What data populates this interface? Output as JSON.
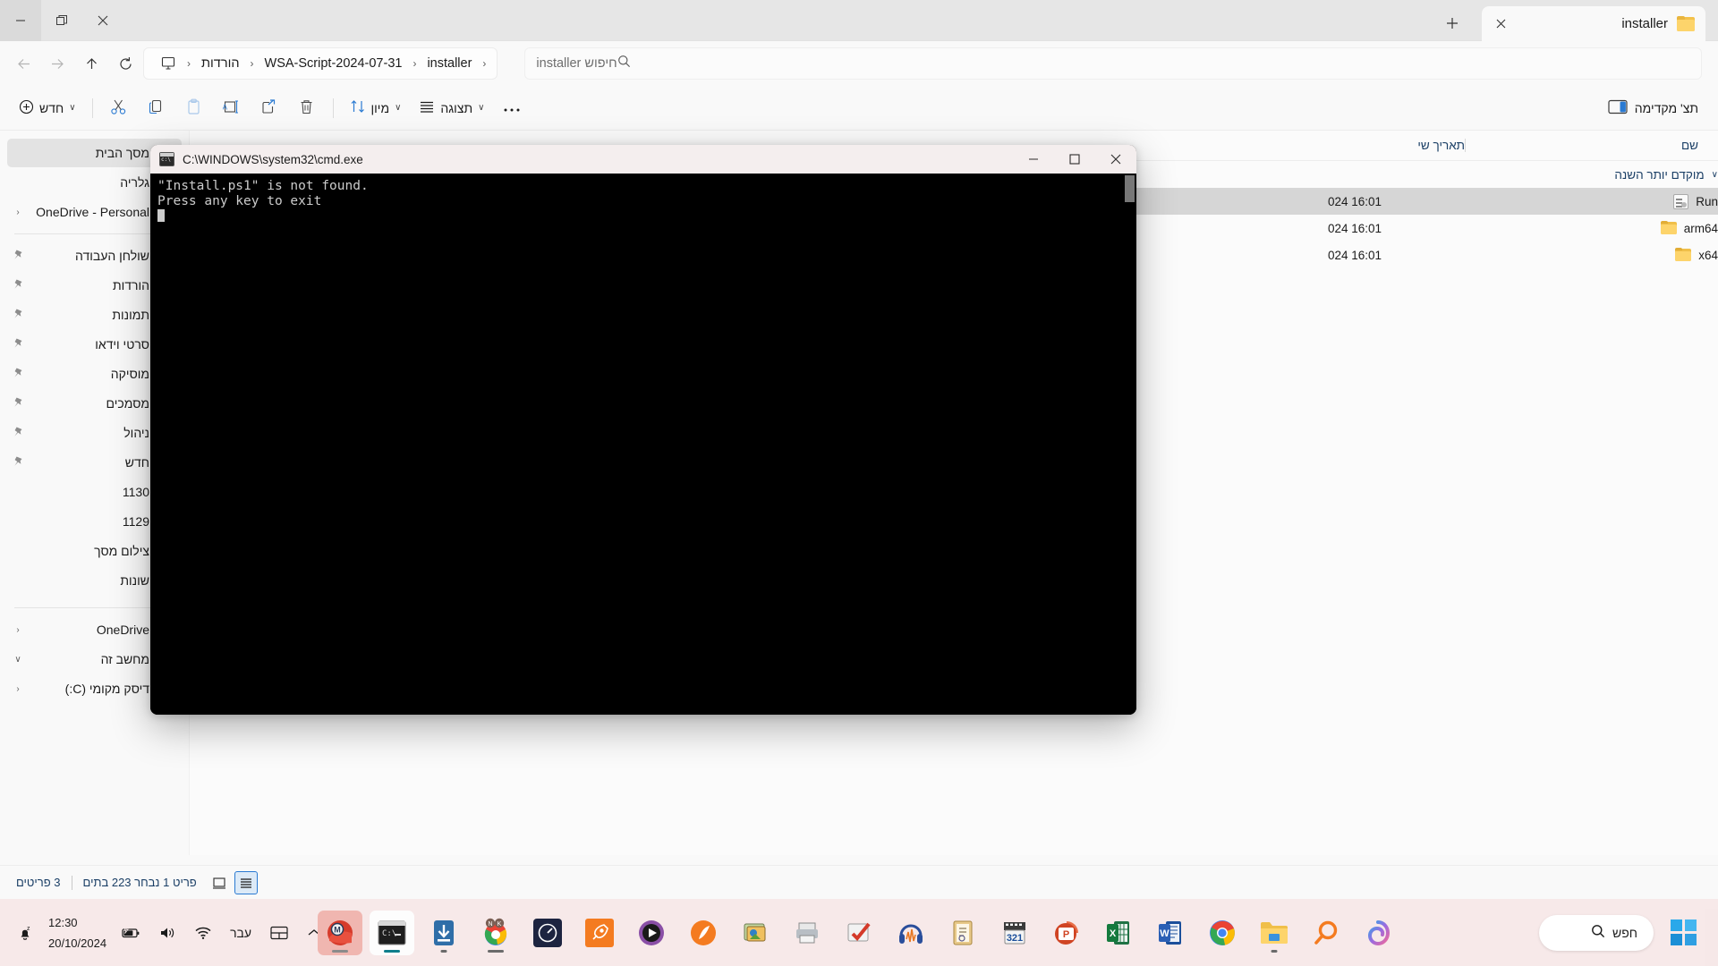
{
  "window": {
    "tab_title": "installer",
    "tab_close_icon": "close-icon",
    "newtab_icon": "plus-icon",
    "controls": {
      "minimize": "minimize-icon",
      "maximize": "restore-icon",
      "close": "close-icon"
    }
  },
  "nav": {
    "back_icon": "arrow-back-icon",
    "forward_icon": "arrow-forward-icon",
    "up_icon": "arrow-up-icon",
    "refresh_icon": "refresh-icon",
    "breadcrumbs": [
      {
        "label": "installer",
        "icon": ""
      },
      {
        "label": "WSA-Script-2024-07-31",
        "icon": ""
      },
      {
        "label": "הורדות",
        "icon": ""
      },
      {
        "label": "",
        "icon": "this-pc-icon"
      }
    ],
    "separator": "‹"
  },
  "search": {
    "placeholder": "חיפוש installer",
    "icon": "search-icon"
  },
  "toolbar": {
    "new_label": "חדש",
    "new_icon": "plus-circle-icon",
    "cut_icon": "scissors-icon",
    "copy_icon": "copy-icon",
    "paste_icon": "paste-icon",
    "rename_icon": "rename-icon",
    "share_icon": "share-icon",
    "delete_icon": "trash-icon",
    "sort_label": "מיון",
    "sort_icon": "sort-icon",
    "view_label": "תצוגה",
    "view_icon": "list-icon",
    "more_icon": "ellipsis-icon",
    "preview_label": "תצ' מקדימה",
    "preview_icon": "preview-pane-icon",
    "chevron": "∨"
  },
  "columns": {
    "name": "שם",
    "date": "תאריך שי"
  },
  "group": {
    "label": "מוקדם יותר השנה",
    "chevron": "∨"
  },
  "files": [
    {
      "name": "Run",
      "date": "024 16:01",
      "icon": "script-file-icon",
      "selected": true
    },
    {
      "name": "arm64",
      "date": "024 16:01",
      "icon": "folder-icon",
      "selected": false
    },
    {
      "name": "x64",
      "date": "024 16:01",
      "icon": "folder-icon",
      "selected": false
    }
  ],
  "sidebar": [
    {
      "label": "מסך הבית",
      "icon": "home-icon",
      "active": true,
      "pin": false,
      "expander": ""
    },
    {
      "label": "גלריה",
      "icon": "gallery-icon",
      "active": false,
      "pin": false,
      "expander": ""
    },
    {
      "label": "OneDrive - Personal",
      "icon": "onedrive-icon",
      "active": false,
      "pin": false,
      "expander": "‹"
    },
    {
      "sep": true
    },
    {
      "label": "שולחן העבודה",
      "icon": "desktop-icon",
      "active": false,
      "pin": true,
      "expander": ""
    },
    {
      "label": "הורדות",
      "icon": "downloads-icon",
      "active": false,
      "pin": true,
      "expander": ""
    },
    {
      "label": "תמונות",
      "icon": "pictures-icon",
      "active": false,
      "pin": true,
      "expander": ""
    },
    {
      "label": "סרטי וידאו",
      "icon": "videos-icon",
      "active": false,
      "pin": true,
      "expander": ""
    },
    {
      "label": "מוסיקה",
      "icon": "music-icon",
      "active": false,
      "pin": true,
      "expander": ""
    },
    {
      "label": "מסמכים",
      "icon": "documents-icon",
      "active": false,
      "pin": true,
      "expander": ""
    },
    {
      "label": "ניהול",
      "icon": "folder-icon",
      "active": false,
      "pin": true,
      "expander": ""
    },
    {
      "label": "חדש",
      "icon": "folder-icon",
      "active": false,
      "pin": true,
      "expander": ""
    },
    {
      "label": "1130",
      "icon": "folder-icon",
      "active": false,
      "pin": false,
      "expander": ""
    },
    {
      "label": "1129",
      "icon": "folder-icon",
      "active": false,
      "pin": false,
      "expander": ""
    },
    {
      "label": "צילום מסך",
      "icon": "folder-icon",
      "active": false,
      "pin": false,
      "expander": ""
    },
    {
      "label": "שונות",
      "icon": "folder-icon",
      "active": false,
      "pin": false,
      "expander": ""
    },
    {
      "sep": true
    },
    {
      "label": "OneDrive",
      "icon": "onedrive-icon",
      "active": false,
      "pin": false,
      "expander": "‹"
    },
    {
      "label": "מחשב זה",
      "icon": "this-pc-icon",
      "active": false,
      "pin": false,
      "expander": "∨"
    },
    {
      "label": "דיסק מקומי (C:)",
      "icon": "drive-icon",
      "active": false,
      "pin": false,
      "expander": "‹"
    }
  ],
  "status": {
    "items_count": "3 פריטים",
    "selection": "פריט 1 נבחר  223 בתים",
    "view_grid_icon": "grid-view-icon",
    "view_details_icon": "details-view-icon"
  },
  "cmd": {
    "title": "C:\\WINDOWS\\system32\\cmd.exe",
    "icon": "cmd-icon",
    "minimize": "–",
    "maximize": "☐",
    "close": "✕",
    "lines": [
      "\"Install.ps1\" is not found.",
      "Press any key to exit"
    ]
  },
  "taskbar": {
    "notification_icon": "notification-bell-icon",
    "time": "12:30",
    "date": "20/10/2024",
    "battery_icon": "battery-charging-icon",
    "volume_icon": "volume-icon",
    "wifi_icon": "wifi-icon",
    "keyboard_layout": "עבר",
    "widgets_icon": "widgets-icon",
    "overflow_icon": "show-hidden-icons-chevron",
    "search_pill": {
      "label": "חפש",
      "icon": "search-icon"
    },
    "start_icon": "windows-start-icon",
    "apps": [
      {
        "name": "mega-sync-app",
        "state": "active-red",
        "indicator": "grey-bar"
      },
      {
        "name": "command-prompt-app",
        "state": "active-white",
        "indicator": "teal"
      },
      {
        "name": "downloader-app",
        "state": "",
        "indicator": "dot"
      },
      {
        "name": "chrome-canary-app",
        "state": "",
        "indicator": "bar"
      },
      {
        "name": "speedtest-app",
        "state": "",
        "indicator": ""
      },
      {
        "name": "rocket-launcher-app",
        "state": "",
        "indicator": ""
      },
      {
        "name": "media-player-app",
        "state": "",
        "indicator": ""
      },
      {
        "name": "nitro-pdf-app",
        "state": "",
        "indicator": ""
      },
      {
        "name": "photo-viewer-app",
        "state": "",
        "indicator": ""
      },
      {
        "name": "printer-app",
        "state": "",
        "indicator": ""
      },
      {
        "name": "checkmark-app",
        "state": "",
        "indicator": ""
      },
      {
        "name": "audacity-app",
        "state": "",
        "indicator": ""
      },
      {
        "name": "notes-app",
        "state": "",
        "indicator": ""
      },
      {
        "name": "media-321-app",
        "state": "",
        "indicator": ""
      },
      {
        "name": "powerpoint-app",
        "state": "",
        "indicator": ""
      },
      {
        "name": "excel-app",
        "state": "",
        "indicator": ""
      },
      {
        "name": "word-app",
        "state": "",
        "indicator": ""
      },
      {
        "name": "chrome-app",
        "state": "",
        "indicator": ""
      },
      {
        "name": "file-explorer-app",
        "state": "",
        "indicator": "dot"
      },
      {
        "name": "search-magnifier-app",
        "state": "",
        "indicator": ""
      },
      {
        "name": "copilot-app",
        "state": "",
        "indicator": ""
      }
    ]
  },
  "colors": {
    "accent": "#2a7ad2",
    "link_text": "#1b3f66",
    "folder": "#fdd46b",
    "taskbar_bg": "#f6e8e8",
    "selection": "#d6d6d6"
  }
}
